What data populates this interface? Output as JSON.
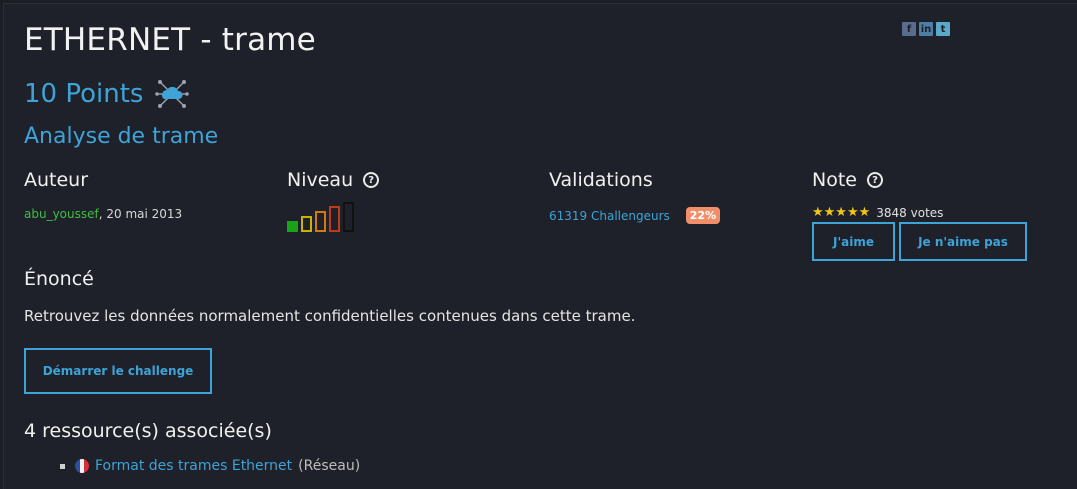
{
  "share": {
    "icons": [
      "facebook-icon",
      "linkedin-icon",
      "twitter-icon"
    ]
  },
  "challenge": {
    "title": "ETHERNET - trame",
    "points": "10 Points",
    "category": "Analyse de trame"
  },
  "author": {
    "heading": "Auteur",
    "username": "abu_youssef",
    "date": ",  20 mai 2013"
  },
  "level": {
    "heading": "Niveau",
    "value": 1,
    "max": 5,
    "colors": [
      "#1aa31a",
      "#c8b400",
      "#d07a10",
      "#c03a1a",
      "#111111"
    ]
  },
  "validations": {
    "heading": "Validations",
    "count": "61319 Challengeurs",
    "percent": "22%"
  },
  "note": {
    "heading": "Note",
    "stars": "★★★★★",
    "votes": "3848 votes",
    "like_label": "J'aime",
    "dislike_label": "Je n'aime pas"
  },
  "statement": {
    "heading": "Énoncé",
    "text": "Retrouvez les données normalement confidentielles contenues dans cette trame.",
    "start_label": "Démarrer le challenge"
  },
  "resources": {
    "heading": "4 ressource(s) associée(s)",
    "items": [
      {
        "title": "Format des trames Ethernet",
        "category": "(Réseau)"
      }
    ]
  },
  "colors": {
    "accent": "#3ea3d6",
    "background": "#1e2129",
    "author": "#3fbf3f",
    "badge": "#f28f6b"
  }
}
